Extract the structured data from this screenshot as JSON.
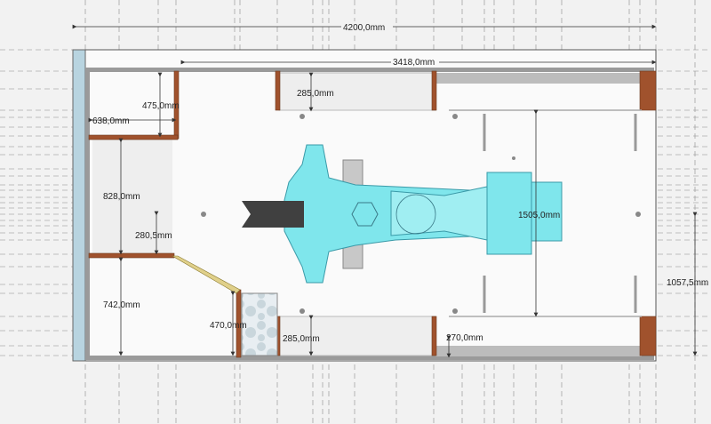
{
  "dimensions": {
    "overall_length": "4200,0mm",
    "inner_length": "3418,0mm",
    "cabinet_top_depth": "475,0mm",
    "cabinet_top_width": "638,0mm",
    "left_opening": "828,0mm",
    "left_offset": "280,5mm",
    "left_lower": "742,0mm",
    "bay_top_depth": "285,0mm",
    "bay_bottom_depth": "285,0mm",
    "block_depth": "470,0mm",
    "cockpit_length": "1505,0mm",
    "bottom_right_depth": "270,0mm",
    "right_half_width": "1057,5mm"
  },
  "colors": {
    "background": "#f2f2f2",
    "floor": "#fafafa",
    "wall": "#9a9a9a",
    "wood": "#a0522d",
    "cockpit": "#7fe6ec",
    "cockpit_stroke": "#3a9aa8",
    "nose": "#404040",
    "glass": "#b8d4e0",
    "counter": "#bcbcbc"
  },
  "icons": {
    "nose": "nose-cone-icon",
    "seat": "hexagon-seat-icon",
    "wheel": "steering-wheel-icon"
  }
}
